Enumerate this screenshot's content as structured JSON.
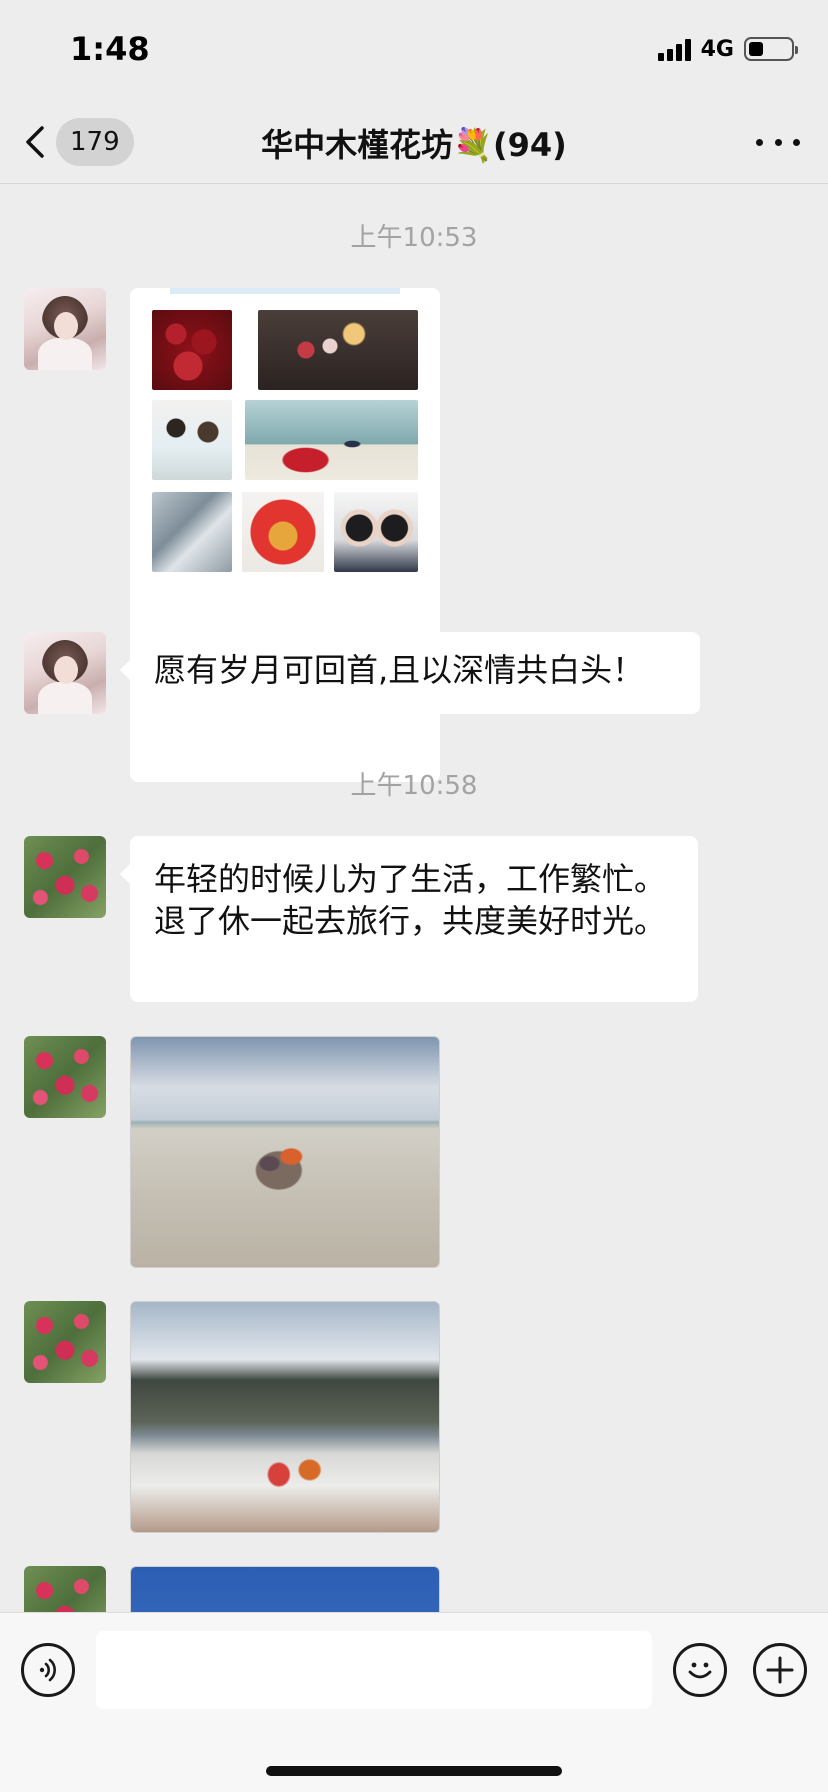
{
  "status_bar": {
    "time": "1:48",
    "network": "4G",
    "battery_level": 0.35
  },
  "nav": {
    "unread_count": "179",
    "title": "华中木槿花坊💐(94)",
    "back_icon": "chevron-left-icon",
    "more_icon": "ellipsis-icon"
  },
  "chat": {
    "timestamps": [
      "上午10:53",
      "上午10:58"
    ],
    "messages": {
      "text_1": "愿有岁月可回首,且以深情共白头！",
      "text_2": "年轻的时候儿为了生活，工作繁忙。退了休一起去旅行，共度美好时光。"
    }
  },
  "input_bar": {
    "voice_icon": "voice-icon",
    "emoji_icon": "emoji-icon",
    "plus_icon": "plus-icon",
    "placeholder": ""
  },
  "colors": {
    "background": "#ededed",
    "bubble": "#ffffff",
    "timestamp": "#a3a3a3"
  }
}
